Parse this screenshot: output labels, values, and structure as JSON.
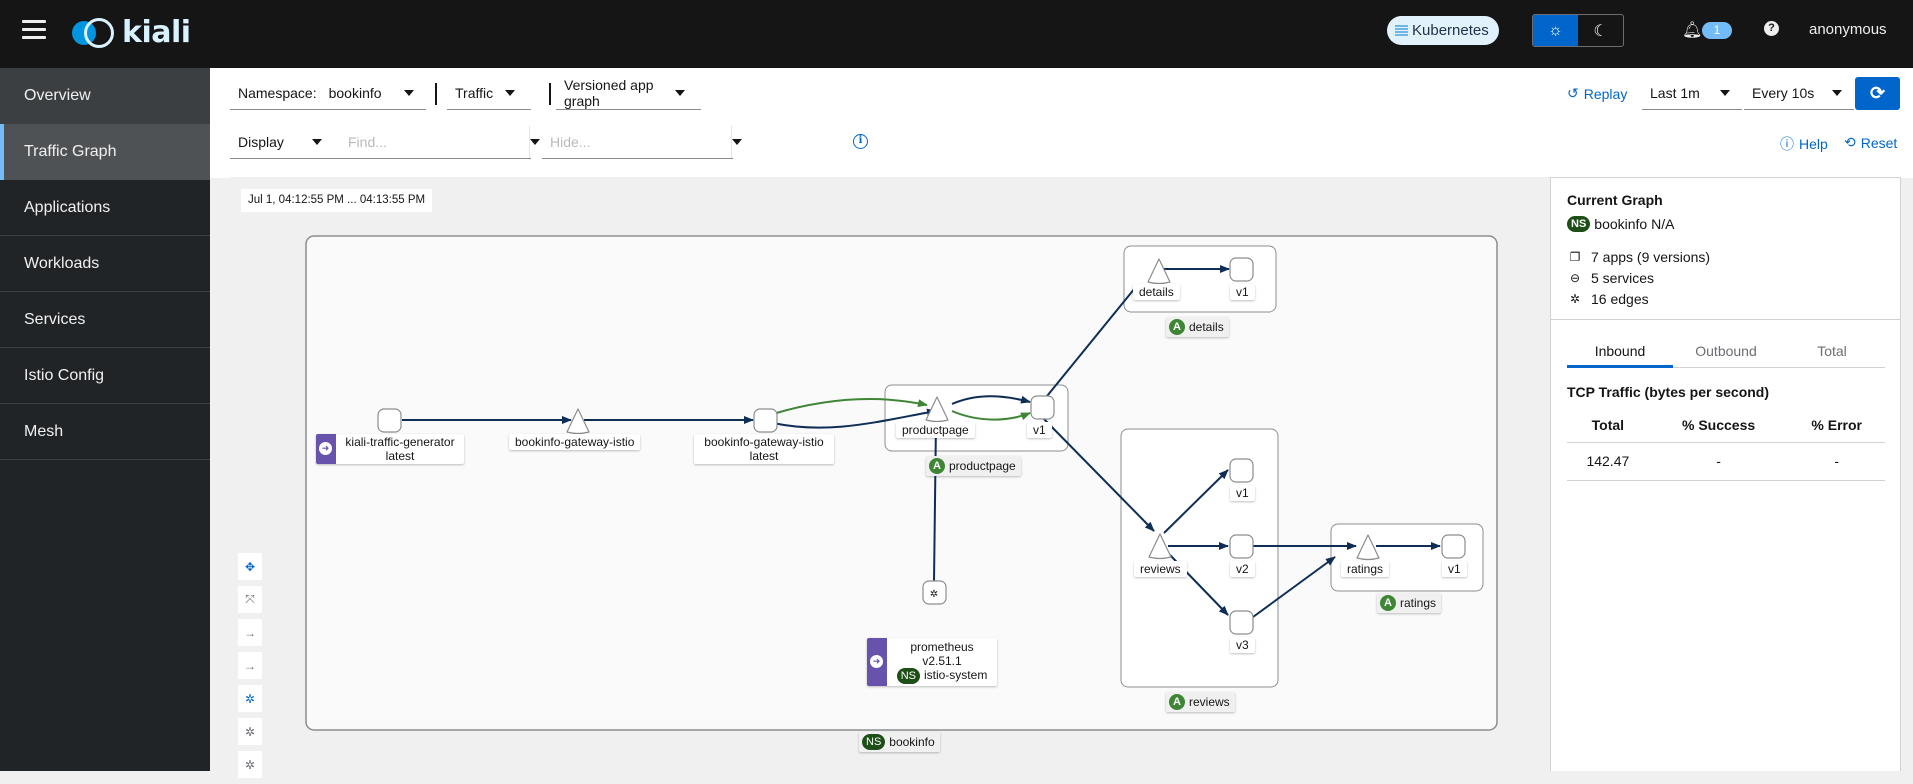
{
  "app": {
    "logo_text": "kiali"
  },
  "masthead": {
    "cluster_badge": "Kubernetes",
    "theme": {
      "light_icon": "sun-icon",
      "dark_icon": "moon-icon",
      "active": "light"
    },
    "notifications_count": "1",
    "help_glyph": "?",
    "user": "anonymous"
  },
  "sidebar": {
    "items": [
      {
        "label": "Overview"
      },
      {
        "label": "Traffic Graph",
        "active": true
      },
      {
        "label": "Applications"
      },
      {
        "label": "Workloads"
      },
      {
        "label": "Services"
      },
      {
        "label": "Istio Config"
      },
      {
        "label": "Mesh"
      }
    ]
  },
  "toolbar": {
    "namespace_label": "Namespace:",
    "namespace_value": "bookinfo",
    "traffic": "Traffic",
    "graph_type": "Versioned app graph",
    "display": "Display",
    "find_placeholder": "Find...",
    "hide_placeholder": "Hide...",
    "replay": "Replay",
    "duration": "Last 1m",
    "refresh_interval": "Every 10s",
    "help": "Help",
    "reset": "Reset"
  },
  "graph": {
    "timestamp": "Jul 1, 04:12:55 PM ... 04:13:55 PM",
    "namespace_box_label": "bookinfo",
    "nodes": {
      "traffic_gen": {
        "line1": "kiali-traffic-generator",
        "line2": "latest"
      },
      "gateway_svc": {
        "line1": "bookinfo-gateway-istio"
      },
      "gateway_wl": {
        "line1": "bookinfo-gateway-istio",
        "line2": "latest"
      },
      "productpage_svc": "productpage",
      "productpage_v1": "v1",
      "details_svc": "details",
      "details_v1": "v1",
      "reviews_svc": "reviews",
      "reviews_v1": "v1",
      "reviews_v2": "v2",
      "reviews_v3": "v3",
      "ratings_svc": "ratings",
      "ratings_v1": "v1",
      "prometheus": {
        "line1": "prometheus",
        "line2": "v2.51.1",
        "ns": "istio-system"
      }
    },
    "app_boxes": {
      "productpage": "productpage",
      "details": "details",
      "reviews": "reviews",
      "ratings": "ratings"
    },
    "badges": {
      "app": "A",
      "namespace": "NS"
    },
    "colors": {
      "edge_tcp": "#0f2e56",
      "edge_http": "#3e8635",
      "namespace_pill": "#1e4f18",
      "app_pill": "#3e8635",
      "external_badge": "#6753ac"
    }
  },
  "side_tools": [
    "move-icon",
    "fit-icon",
    "layout-1-icon",
    "layout-2-icon",
    "layout-cola-icon",
    "layout-dagre-icon",
    "layout-grid-icon"
  ],
  "panel": {
    "title": "Current Graph",
    "ns_badge": "NS",
    "namespace": "bookinfo N/A",
    "apps": "7 apps (9 versions)",
    "services": "5 services",
    "edges": "16 edges",
    "tabs": [
      "Inbound",
      "Outbound",
      "Total"
    ],
    "active_tab": "Inbound",
    "tcp_title": "TCP Traffic (bytes per second)",
    "table": {
      "headers": [
        "Total",
        "% Success",
        "% Error"
      ],
      "row": [
        "142.47",
        "-",
        "-"
      ]
    }
  }
}
